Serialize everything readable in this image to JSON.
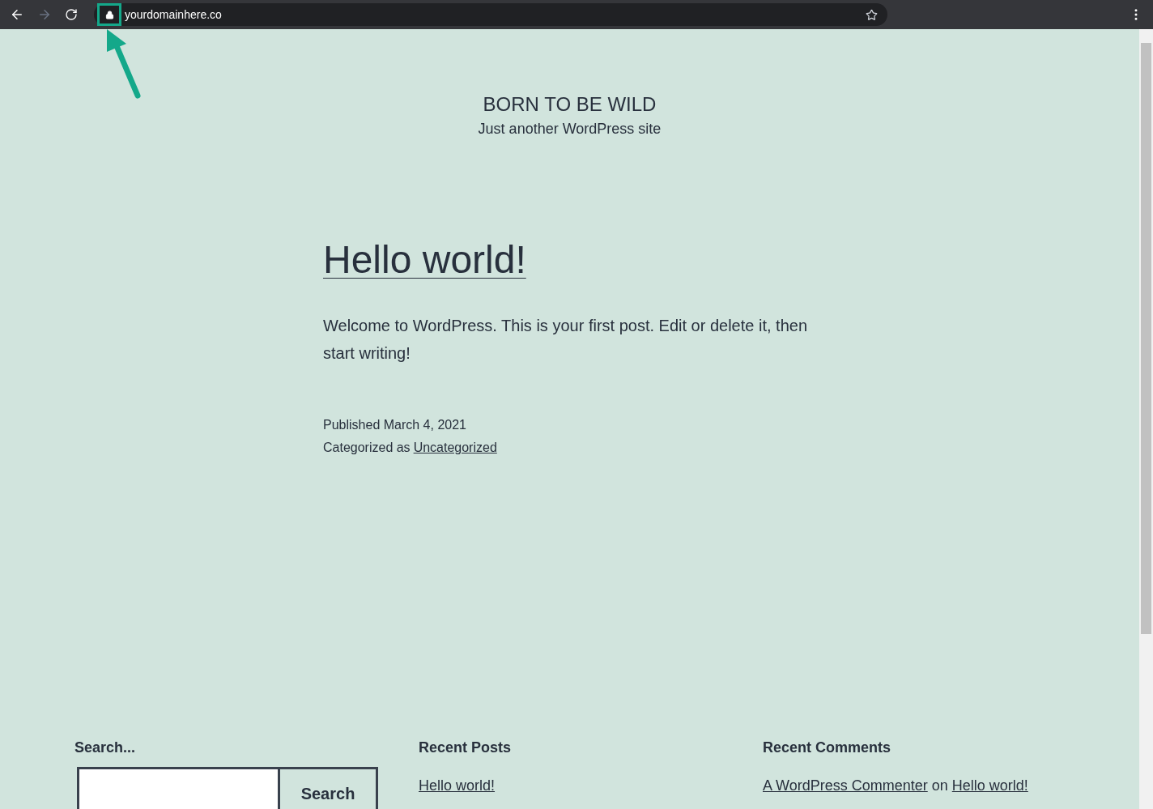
{
  "browser": {
    "url": "yourdomainhere.co"
  },
  "site": {
    "title": "BORN TO BE WILD",
    "tagline": "Just another WordPress site"
  },
  "post": {
    "title": "Hello world!",
    "body": "Welcome to WordPress. This is your first post. Edit or delete it, then start writing!",
    "published": "Published March 4, 2021",
    "category_prefix": "Categorized as",
    "category": "Uncategorized"
  },
  "footer": {
    "search": {
      "label": "Search...",
      "button": "Search"
    },
    "recent_posts": {
      "heading": "Recent Posts",
      "items": [
        "Hello world!"
      ]
    },
    "recent_comments": {
      "heading": "Recent Comments",
      "items": [
        {
          "author": "A WordPress Commenter",
          "connector": "on",
          "post": "Hello world!"
        }
      ]
    }
  }
}
